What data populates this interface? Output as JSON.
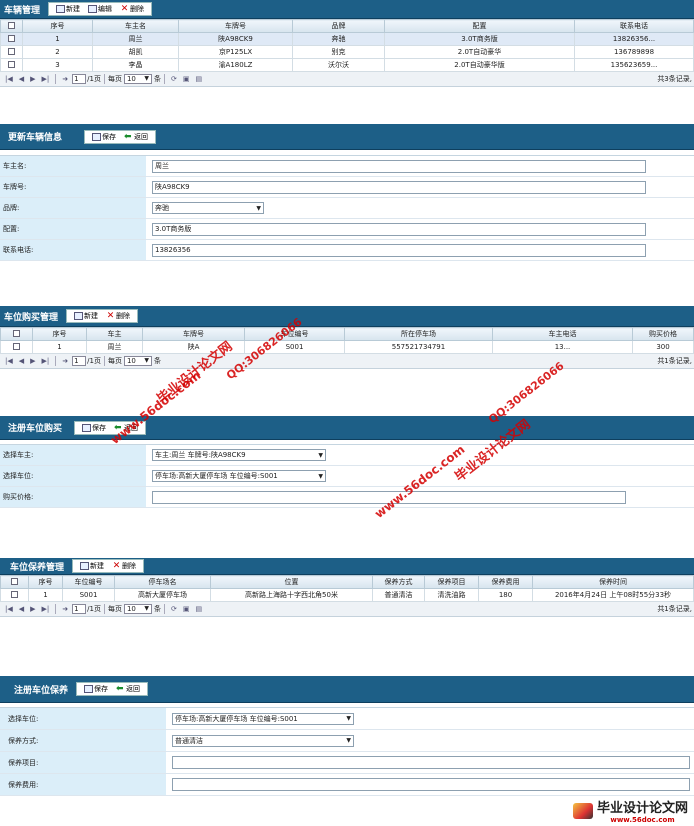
{
  "p1": {
    "title": "车辆管理",
    "buttons": [
      "新建",
      "编辑",
      "删除"
    ],
    "cols": [
      "序号",
      "车主名",
      "车牌号",
      "品牌",
      "配置",
      "联系电话"
    ],
    "rows": [
      [
        "1",
        "周兰",
        "陕A98CK9",
        "奔驰",
        "3.0T商务版",
        "13826356..."
      ],
      [
        "2",
        "胡凯",
        "京P125LX",
        "别克",
        "2.0T自动豪华",
        "136789898"
      ],
      [
        "3",
        "李晶",
        "渝A180LZ",
        "沃尔沃",
        "2.0T自动豪华版",
        "135623659..."
      ]
    ],
    "pager": {
      "page": "1",
      "total_pages": "/1页",
      "per": "每页",
      "size": "10",
      "unit": "条",
      "summary": "共3条记录,"
    }
  },
  "p2": {
    "title": "更新车辆信息",
    "buttons": [
      "保存",
      "返回"
    ],
    "fields": [
      {
        "label": "车主名:",
        "value": "周兰"
      },
      {
        "label": "车牌号:",
        "value": "陕A98CK9"
      },
      {
        "label": "品牌:",
        "value": "奔驰"
      },
      {
        "label": "配置:",
        "value": "3.0T商务版"
      },
      {
        "label": "联系电话:",
        "value": "13826356"
      }
    ]
  },
  "p3": {
    "title": "车位购买管理",
    "buttons": [
      "新建",
      "删除"
    ],
    "cols": [
      "序号",
      "车主",
      "车牌号",
      "车位编号",
      "所在停车场",
      "车主电话",
      "购买价格"
    ],
    "rows": [
      [
        "1",
        "周兰",
        "陕A",
        "S001",
        "557521734791",
        "13...",
        "300"
      ]
    ],
    "pager": {
      "page": "1",
      "total_pages": "/1页",
      "per": "每页",
      "size": "10",
      "unit": "条",
      "summary": "共1条记录,"
    }
  },
  "p4": {
    "title": "注册车位购买",
    "buttons": [
      "保存",
      "返回"
    ],
    "fields": [
      {
        "label": "选择车主:",
        "value": "车主:周兰 车牌号:陕A98CK9"
      },
      {
        "label": "选择车位:",
        "value": "停车场:高新大厦停车场 车位编号:S001"
      },
      {
        "label": "购买价格:",
        "value": ""
      }
    ]
  },
  "p5": {
    "title": "车位保养管理",
    "buttons": [
      "新建",
      "删除"
    ],
    "cols": [
      "序号",
      "车位编号",
      "停车场名",
      "位置",
      "保养方式",
      "保养项目",
      "保养费用",
      "保养时间"
    ],
    "rows": [
      [
        "1",
        "S001",
        "高新大厦停车场",
        "高新路上海路十字西北角50米",
        "普通清洁",
        "清洗油路",
        "180",
        "2016年4月24日 上午08时55分33秒"
      ]
    ],
    "pager": {
      "page": "1",
      "total_pages": "/1页",
      "per": "每页",
      "size": "10",
      "unit": "条",
      "summary": "共1条记录,"
    }
  },
  "p6": {
    "title": "注册车位保养",
    "buttons": [
      "保存",
      "返回"
    ],
    "fields": [
      {
        "label": "选择车位:",
        "value": "停车场:高新大厦停车场 车位编号:S001"
      },
      {
        "label": "保养方式:",
        "value": "普通清洁"
      },
      {
        "label": "保养项目:",
        "value": ""
      },
      {
        "label": "保养费用:",
        "value": ""
      }
    ]
  },
  "watermark": {
    "site": "www.56doc.com",
    "qq": "QQ:306826066",
    "name": "毕业设计论文网"
  },
  "footer": {
    "name": "毕业设计论文网",
    "url": "www.56doc.com"
  }
}
